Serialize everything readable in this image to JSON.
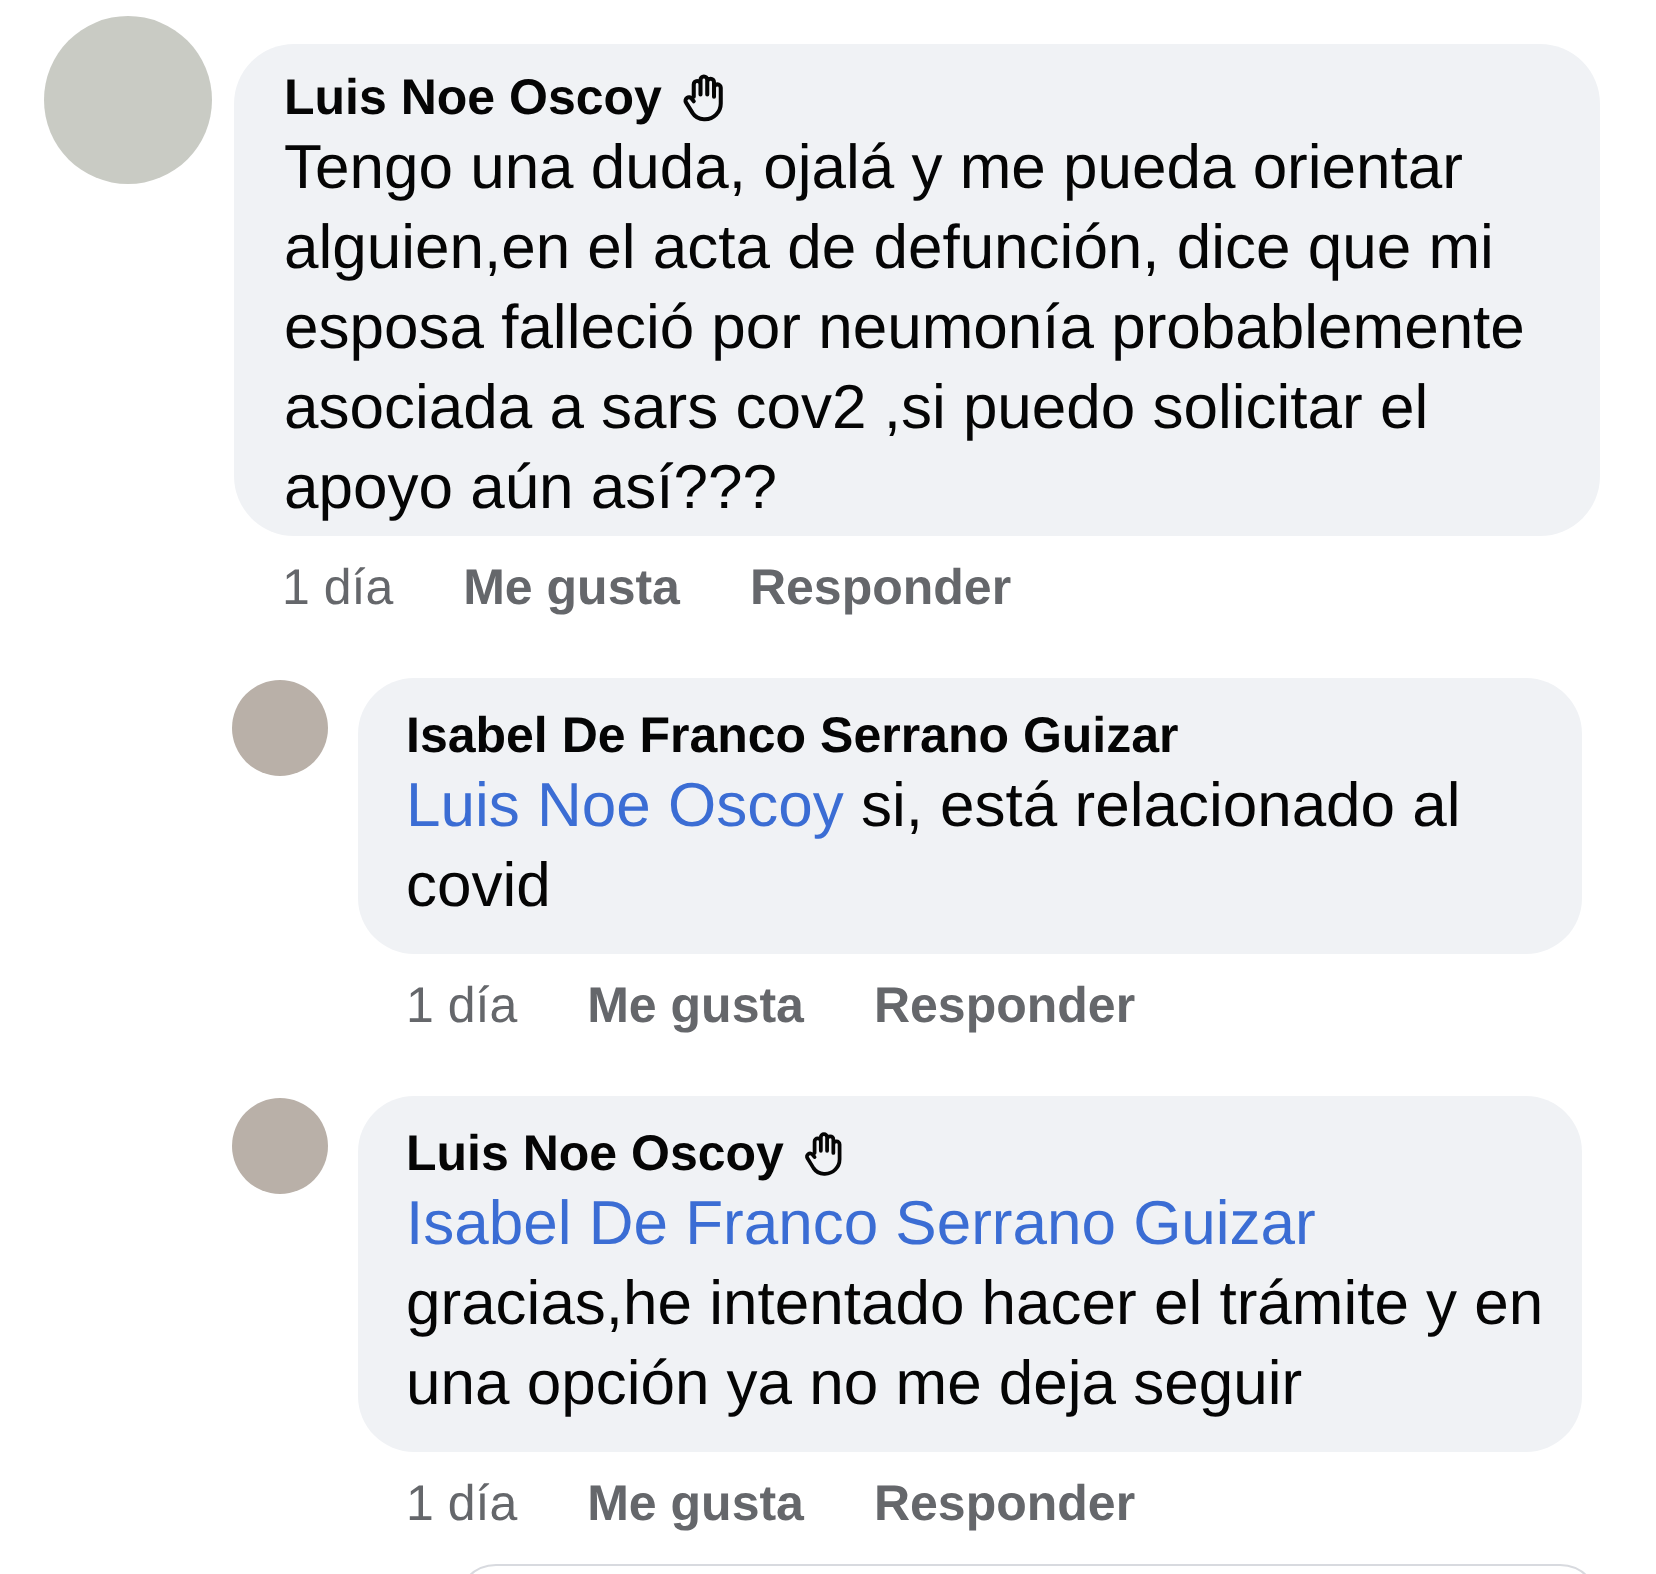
{
  "comments": [
    {
      "author": "Luis Noe Oscoy",
      "badge": true,
      "text": "Tengo una duda, ojalá y me pueda orientar alguien,en el acta de defunción, dice que mi esposa falleció por neumonía probablemente asociada a sars cov2 ,si puedo solicitar el apoyo aún así???",
      "time": "1 día",
      "like": "Me gusta",
      "reply": "Responder",
      "replies": [
        {
          "author": "Isabel De Franco Serrano Guizar",
          "badge": false,
          "mention": "Luis Noe Oscoy",
          "text": "si, está relacionado al covid",
          "time": "1 día",
          "like": "Me gusta",
          "reply": "Responder"
        },
        {
          "author": "Luis Noe Oscoy",
          "badge": true,
          "mention": "Isabel De Franco Serrano Guizar",
          "text": "gracias,he intentado hacer el trámite y en una opción ya no me deja seguir",
          "time": "1 día",
          "like": "Me gusta",
          "reply": "Responder"
        }
      ]
    }
  ]
}
